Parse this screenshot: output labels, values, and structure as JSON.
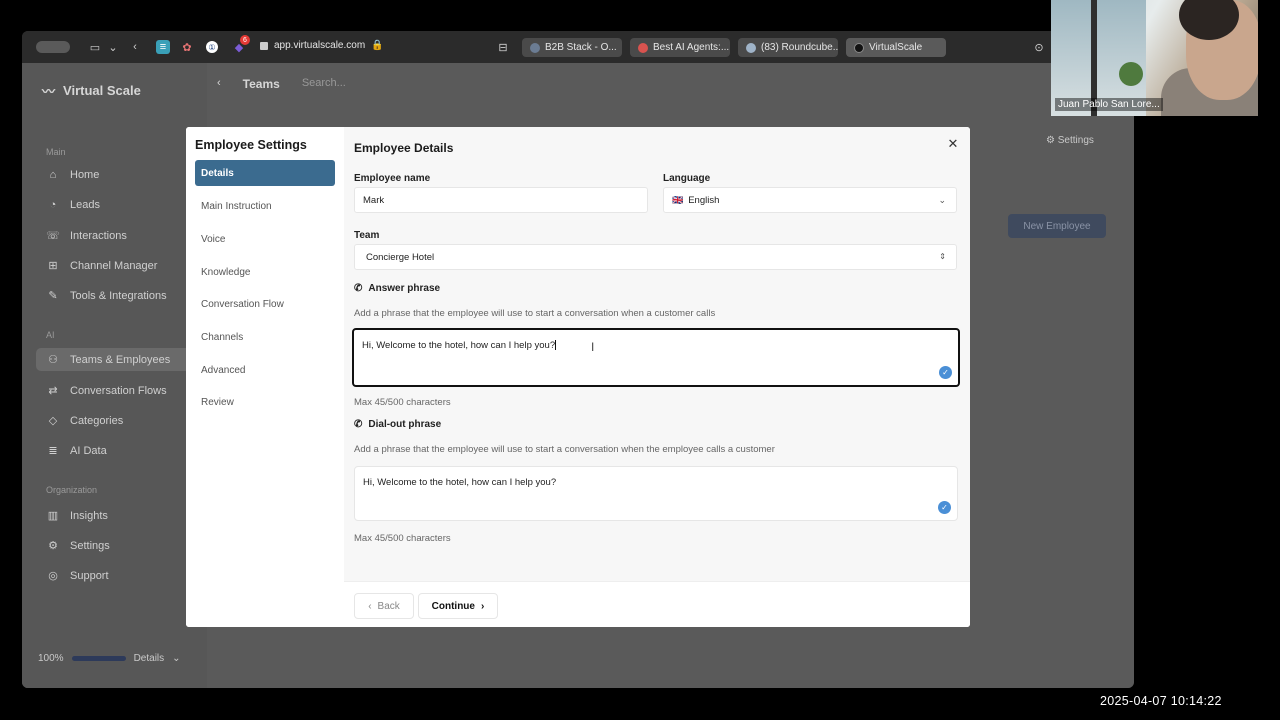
{
  "browser": {
    "url": "app.virtualscale.com",
    "badge": "6",
    "tabs": [
      {
        "label": "B2B Stack - O...",
        "color": "#6b7c93"
      },
      {
        "label": "Best AI Agents:...",
        "color": "#d9534f"
      },
      {
        "label": "(83) Roundcube...",
        "color": "#9fb3c8"
      },
      {
        "label": "VirtualScale",
        "color": "#111111"
      }
    ]
  },
  "app": {
    "logo": "Virtual Scale",
    "sections": {
      "main": "Main",
      "ai": "AI",
      "org": "Organization"
    },
    "nav": {
      "home": "Home",
      "leads": "Leads",
      "interactions": "Interactions",
      "channel_manager": "Channel Manager",
      "tools": "Tools & Integrations",
      "teams": "Teams & Employees",
      "flows": "Conversation Flows",
      "categories": "Categories",
      "ai_data": "AI Data",
      "insights": "Insights",
      "settings": "Settings",
      "support": "Support"
    },
    "zoom": "100%",
    "zoom_level": 1.0,
    "zoom_mode": "Details",
    "topbar": {
      "title": "Teams",
      "search": "Search..."
    },
    "settings_link": "Settings",
    "new_employee": "New Employee"
  },
  "modal": {
    "title": "Employee Settings",
    "steps": [
      "Details",
      "Main Instruction",
      "Voice",
      "Knowledge",
      "Conversation Flow",
      "Channels",
      "Advanced",
      "Review"
    ],
    "heading": "Employee Details",
    "employee_name_label": "Employee name",
    "employee_name": "Mark",
    "language_label": "Language",
    "language_flag": "🇬🇧",
    "language": "English",
    "team_label": "Team",
    "team": "Concierge Hotel",
    "answer": {
      "label": "Answer phrase",
      "help": "Add a phrase that the employee will use to start a conversation when a customer calls",
      "value": "Hi, Welcome to the hotel, how can I help you?",
      "count": "Max 45/500 characters"
    },
    "dialout": {
      "label": "Dial-out phrase",
      "help": "Add a phrase that the employee will use to start a conversation when the employee calls a customer",
      "value": "Hi, Welcome to the hotel, how can I help you?",
      "count": "Max 45/500 characters"
    },
    "back": "Back",
    "continue": "Continue"
  },
  "webcam": {
    "name": "Juan Pablo San Lore..."
  },
  "clock": "2025-04-07  10:14:22"
}
